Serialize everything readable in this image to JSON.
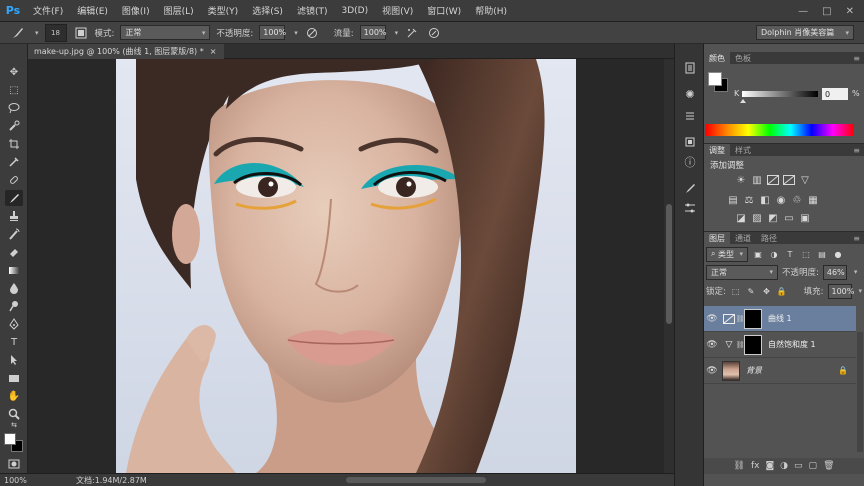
{
  "app": {
    "logo": "Ps"
  },
  "menu": [
    "文件(F)",
    "编辑(E)",
    "图像(I)",
    "图层(L)",
    "类型(Y)",
    "选择(S)",
    "滤镜(T)",
    "3D(D)",
    "视图(V)",
    "窗口(W)",
    "帮助(H)"
  ],
  "window_controls": {
    "minimize": "—",
    "restore": "□",
    "close": "✕"
  },
  "options": {
    "brush_size": "18",
    "mode_label": "模式:",
    "mode_value": "正常",
    "opacity_label": "不透明度:",
    "opacity_value": "100%",
    "flow_label": "流量:",
    "flow_value": "100%",
    "workspace": "Dolphin 肖像美容篇"
  },
  "document": {
    "tab_title": "make-up.jpg @ 100% (曲线 1, 图层蒙版/8) *",
    "close": "×"
  },
  "status": {
    "zoom": "100%",
    "doc_info": "文档:1.94M/2.87M"
  },
  "color_panel": {
    "tabs": [
      "颜色",
      "色板"
    ],
    "channel": "K",
    "value": "0",
    "unit": "%",
    "fg_color": "#ffffff",
    "bg_color": "#000000"
  },
  "adjust_panel": {
    "tabs": [
      "调整",
      "样式"
    ],
    "title": "添加调整"
  },
  "layers_panel": {
    "tabs": [
      "图层",
      "通道",
      "路径"
    ],
    "filter": "类型",
    "blend_mode": "正常",
    "opacity_label": "不透明度:",
    "opacity_value": "46%",
    "lock_label": "锁定:",
    "fill_label": "填充:",
    "fill_value": "100%",
    "layers": [
      {
        "name": "曲线 1",
        "type": "curves",
        "selected": true
      },
      {
        "name": "自然饱和度 1",
        "type": "vibrance",
        "selected": false
      },
      {
        "name": "背景",
        "type": "image",
        "selected": false,
        "locked": true
      }
    ]
  }
}
